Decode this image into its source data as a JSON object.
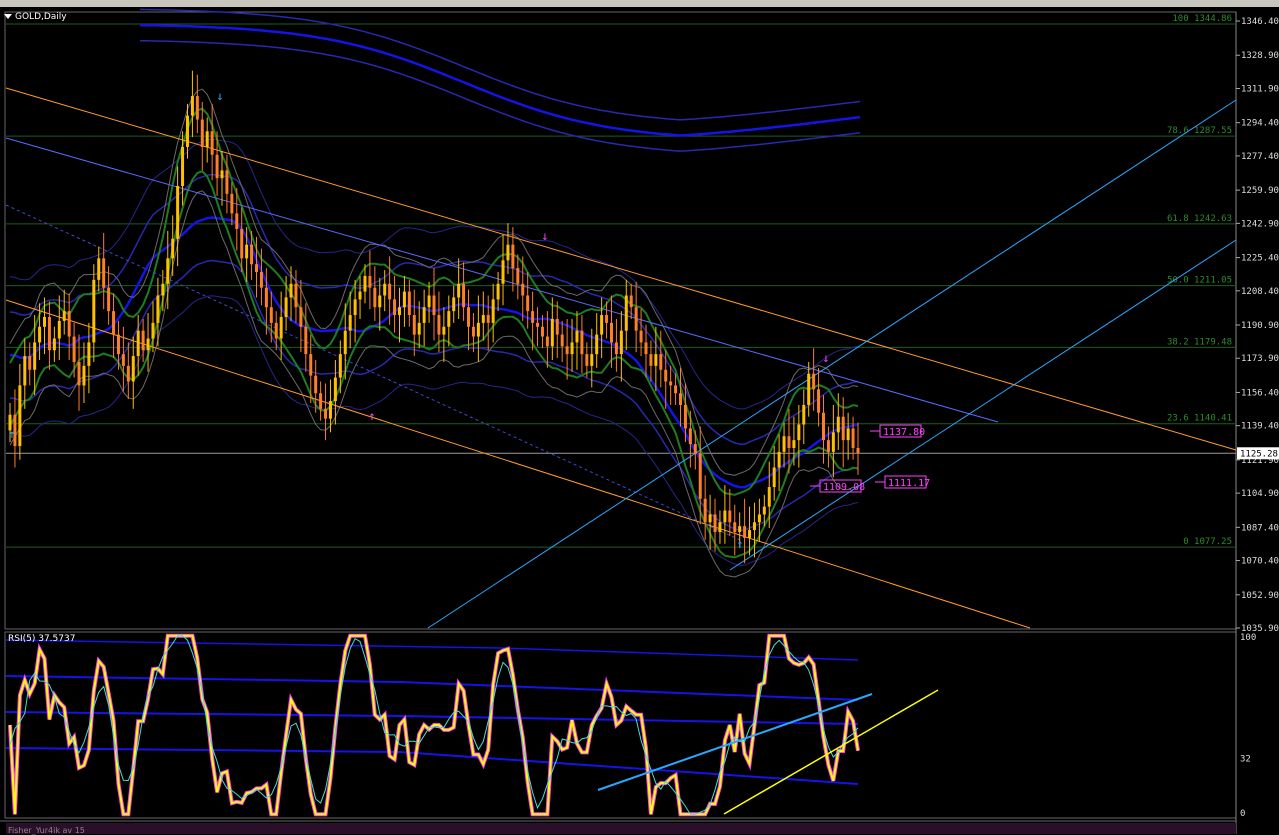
{
  "title": "GOLD,Daily",
  "rsi_title": "RSI(5) 37.5737",
  "fisher_title": "Fisher_Yur4ik av 15",
  "current_price_label": "1125.28",
  "colors": {
    "background": "#000000",
    "grid": "#1d5e1d",
    "candle_up": "#ffc000",
    "candle_down": "#ff7f27",
    "channel_orange": "#ff9a2e",
    "blue_band": "#1414e6",
    "green_band": "#1e7d1e",
    "light_blue": "#2aa7ff",
    "magenta": "#ff40ff",
    "rsi_main": "#ffff00",
    "rsi_signal": "#40e0d0"
  },
  "price_axis": [
    "1346.40",
    "1328.90",
    "1311.90",
    "1294.40",
    "1277.40",
    "1259.90",
    "1242.90",
    "1225.40",
    "1208.40",
    "1190.90",
    "1173.90",
    "1156.40",
    "1139.40",
    "1121.90",
    "1104.90",
    "1087.40",
    "1070.40",
    "1052.90",
    "1035.90"
  ],
  "rsi_axis": [
    "100",
    "32",
    "0"
  ],
  "fib_levels": [
    {
      "label": "100 1344.86",
      "value": 1344.86
    },
    {
      "label": "78.6 1287.55",
      "value": 1287.55
    },
    {
      "label": "61.8 1242.63",
      "value": 1242.63
    },
    {
      "label": "50.0 1211.05",
      "value": 1211.05
    },
    {
      "label": "38.2 1179.48",
      "value": 1179.48
    },
    {
      "label": "23.6 1140.41",
      "value": 1140.41
    },
    {
      "label": "0 1077.25",
      "value": 1077.25
    }
  ],
  "price_tags": [
    "1137.80",
    "1109.08",
    "1111.17"
  ],
  "chart_data": {
    "type": "candlestick",
    "title": "GOLD,Daily",
    "ylim": [
      1035.9,
      1350.0
    ],
    "close": [
      1145,
      1129,
      1160,
      1175,
      1168,
      1182,
      1190,
      1195,
      1178,
      1184,
      1193,
      1198,
      1185,
      1172,
      1160,
      1170,
      1182,
      1214,
      1225,
      1210,
      1198,
      1186,
      1176,
      1170,
      1162,
      1175,
      1188,
      1178,
      1184,
      1192,
      1206,
      1212,
      1225,
      1235,
      1262,
      1282,
      1298,
      1308,
      1296,
      1282,
      1290,
      1278,
      1266,
      1270,
      1258,
      1248,
      1240,
      1225,
      1232,
      1222,
      1218,
      1210,
      1200,
      1192,
      1184,
      1195,
      1205,
      1212,
      1200,
      1190,
      1176,
      1165,
      1156,
      1148,
      1143,
      1152,
      1164,
      1176,
      1188,
      1196,
      1204,
      1208,
      1216,
      1210,
      1200,
      1206,
      1212,
      1204,
      1196,
      1200,
      1208,
      1196,
      1186,
      1192,
      1200,
      1206,
      1196,
      1186,
      1190,
      1198,
      1205,
      1212,
      1200,
      1190,
      1185,
      1192,
      1196,
      1192,
      1204,
      1212,
      1224,
      1232,
      1220,
      1212,
      1206,
      1198,
      1192,
      1190,
      1185,
      1180,
      1194,
      1186,
      1180,
      1176,
      1182,
      1188,
      1176,
      1170,
      1176,
      1186,
      1196,
      1192,
      1182,
      1176,
      1188,
      1206,
      1200,
      1188,
      1182,
      1176,
      1170,
      1176,
      1168,
      1162,
      1160,
      1156,
      1150,
      1138,
      1130,
      1125,
      1102,
      1090,
      1094,
      1085,
      1090,
      1096,
      1090,
      1085,
      1088,
      1082,
      1086,
      1090,
      1094,
      1098,
      1108,
      1118,
      1126,
      1134,
      1128,
      1132,
      1140,
      1150,
      1166,
      1158,
      1146,
      1132,
      1126,
      1136,
      1144,
      1132,
      1138,
      1128,
      1125.28
    ]
  }
}
